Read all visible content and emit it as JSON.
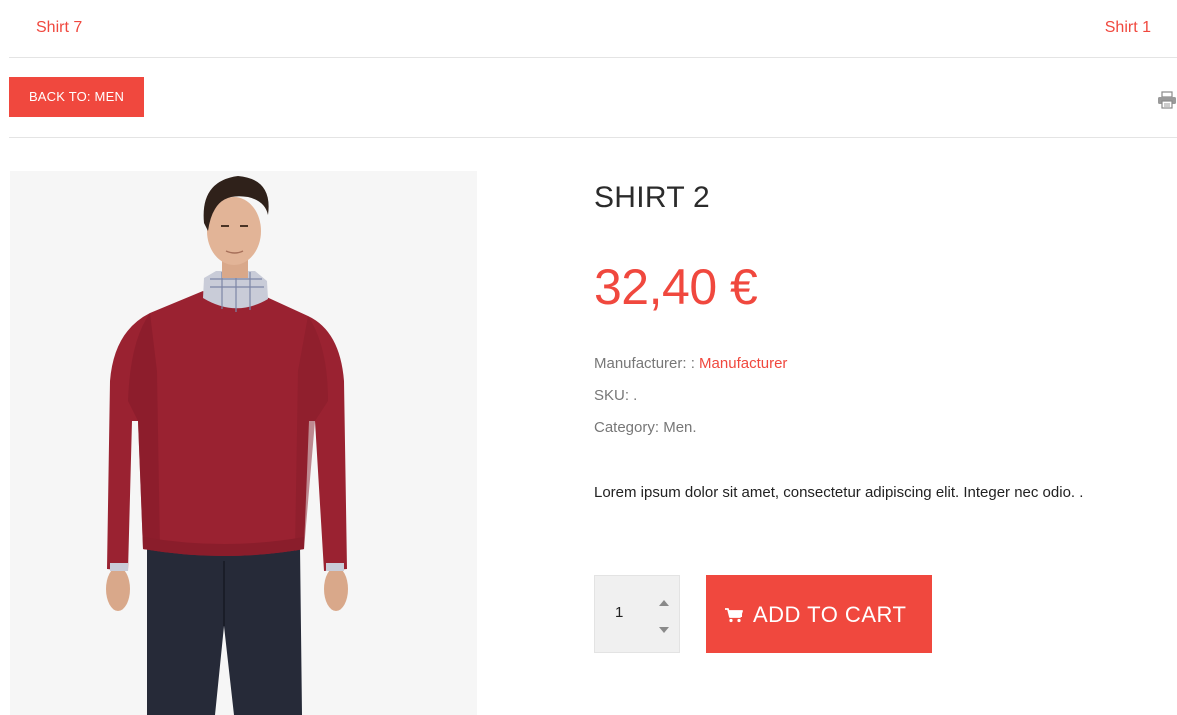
{
  "navigation": {
    "previous": "Shirt 7",
    "next": "Shirt 1"
  },
  "back": {
    "label": "BACK TO: MEN"
  },
  "product": {
    "title": "SHIRT 2",
    "price": "32,40 €",
    "manufacturer_label": "Manufacturer: : ",
    "manufacturer_value": "Manufacturer",
    "sku": "SKU: .",
    "category": "Category: Men.",
    "description": "Lorem ipsum dolor sit amet, consectetur adipiscing elit. Integer nec odio. ."
  },
  "cart": {
    "quantity": "1",
    "add_label": "ADD TO CART"
  },
  "icons": {
    "print": "print-icon",
    "cart": "shopping-cart-icon",
    "up": "caret-up-icon",
    "down": "caret-down-icon"
  },
  "colors": {
    "accent": "#f0483e",
    "text": "#2b2b2b",
    "muted": "#777777",
    "image_bg": "#f6f6f6"
  }
}
